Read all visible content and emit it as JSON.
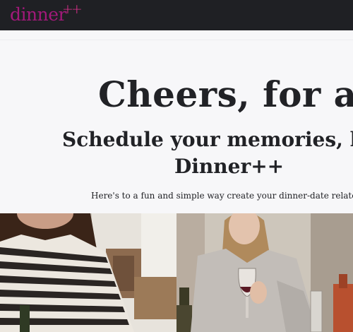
{
  "navbar": {
    "brand_word": "dinner",
    "brand_plus": "++"
  },
  "hero": {
    "headline": "Cheers, for all.",
    "subheadline_line1": "Schedule your memories, here",
    "subheadline_line2": "Dinner++",
    "tagline": "Here's to a fun and simple way create your dinner-date related events"
  },
  "colors": {
    "navbar_bg": "#1f2024",
    "brand": "#a2197a",
    "brand_plus": "#e0318f",
    "hero_bg": "#f7f7f9",
    "text": "#212226"
  }
}
